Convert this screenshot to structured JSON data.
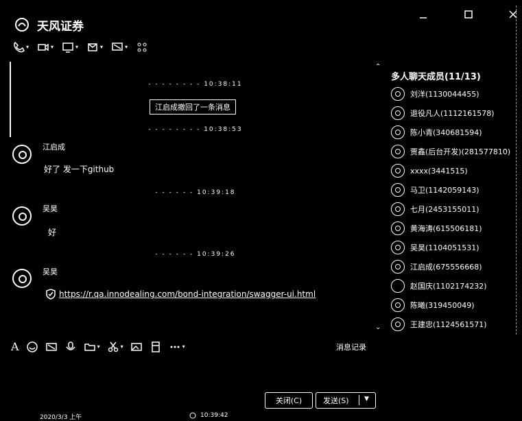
{
  "window": {
    "title": "天风证券"
  },
  "window_controls": [
    "minimize-icon",
    "maximize-icon",
    "close-icon"
  ],
  "chat": {
    "messages": [
      {
        "type": "time",
        "text": "- - - - - - - - 10:38:11"
      },
      {
        "type": "system",
        "text": "江启成撤回了一条消息"
      },
      {
        "type": "time",
        "text": "- - - - - - - - 10:38:53"
      },
      {
        "type": "message",
        "sender": "江启成",
        "text": "好了 发一下github",
        "avatar": "user-avatar-icon"
      },
      {
        "type": "time",
        "text": "- - - - - - 10:39:18"
      },
      {
        "type": "message",
        "sender": "吴昊",
        "text": "好",
        "avatar": "user-avatar-icon"
      },
      {
        "type": "time",
        "text": "- - - - - - 10:39:26"
      },
      {
        "type": "message",
        "sender": "吴昊",
        "link": "https://r.qa.innodealing.com/bond-integration/swagger-ui.html",
        "avatar": "user-avatar-icon"
      }
    ]
  },
  "members": {
    "title": "多人聊天成员(11/13)",
    "list": [
      "刘洋(1130044455)",
      "退役凡人(1112161578)",
      "陈小青(340681594)",
      "贾鑫(后台开发)(281577810)",
      "xxxx(3441515)",
      "马卫(1142059143)",
      "七月(2453155011)",
      "黄海涛(615506181)",
      "吴昊(1104051531)",
      "江启成(675556668)",
      "赵国庆(1102174232)",
      "陈曦(319450049)",
      "王建忠(1124561571)"
    ]
  },
  "toolbar": {
    "message_history": "消息记录"
  },
  "actions": {
    "close": "关闭(C)",
    "send": "发送(S)"
  },
  "status_bar": {
    "left_text": "2020/3/3 上午",
    "right_text": "10:39:42"
  }
}
